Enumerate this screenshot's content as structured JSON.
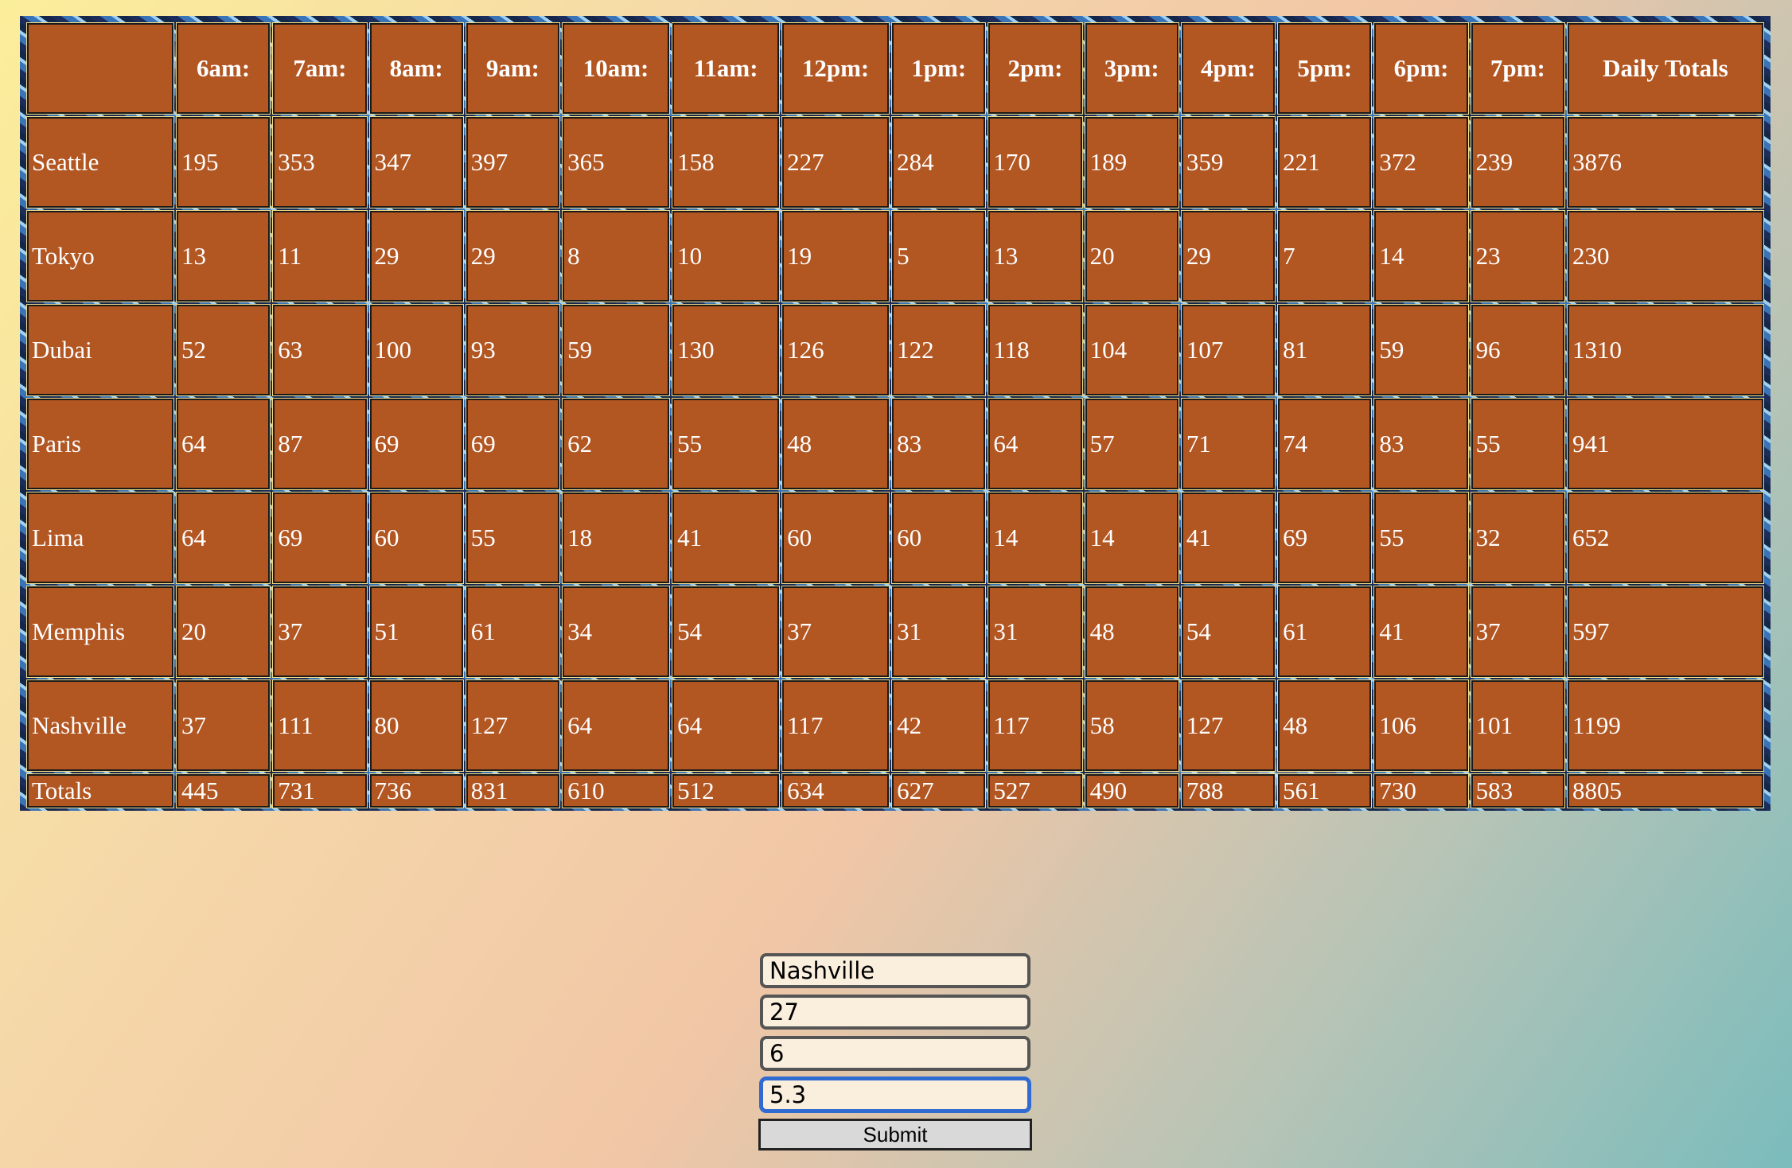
{
  "table": {
    "corner": "",
    "hours": [
      "6am:",
      "7am:",
      "8am:",
      "9am:",
      "10am:",
      "11am:",
      "12pm:",
      "1pm:",
      "2pm:",
      "3pm:",
      "4pm:",
      "5pm:",
      "6pm:",
      "7pm:"
    ],
    "total_header": "Daily Totals",
    "rows": [
      {
        "name": "Seattle",
        "values": [
          "195",
          "353",
          "347",
          "397",
          "365",
          "158",
          "227",
          "284",
          "170",
          "189",
          "359",
          "221",
          "372",
          "239"
        ],
        "total": "3876"
      },
      {
        "name": "Tokyo",
        "values": [
          "13",
          "11",
          "29",
          "29",
          "8",
          "10",
          "19",
          "5",
          "13",
          "20",
          "29",
          "7",
          "14",
          "23"
        ],
        "total": "230"
      },
      {
        "name": "Dubai",
        "values": [
          "52",
          "63",
          "100",
          "93",
          "59",
          "130",
          "126",
          "122",
          "118",
          "104",
          "107",
          "81",
          "59",
          "96"
        ],
        "total": "1310"
      },
      {
        "name": "Paris",
        "values": [
          "64",
          "87",
          "69",
          "69",
          "62",
          "55",
          "48",
          "83",
          "64",
          "57",
          "71",
          "74",
          "83",
          "55"
        ],
        "total": "941"
      },
      {
        "name": "Lima",
        "values": [
          "64",
          "69",
          "60",
          "55",
          "18",
          "41",
          "60",
          "60",
          "14",
          "14",
          "41",
          "69",
          "55",
          "32"
        ],
        "total": "652"
      },
      {
        "name": "Memphis",
        "values": [
          "20",
          "37",
          "51",
          "61",
          "34",
          "54",
          "37",
          "31",
          "31",
          "48",
          "54",
          "61",
          "41",
          "37"
        ],
        "total": "597"
      },
      {
        "name": "Nashville",
        "values": [
          "37",
          "111",
          "80",
          "127",
          "64",
          "64",
          "117",
          "42",
          "117",
          "58",
          "127",
          "48",
          "106",
          "101"
        ],
        "total": "1199"
      }
    ],
    "totals": {
      "label": "Totals",
      "values": [
        "445",
        "731",
        "736",
        "831",
        "610",
        "512",
        "634",
        "627",
        "527",
        "490",
        "788",
        "561",
        "730",
        "583"
      ],
      "grand_total": "8805"
    }
  },
  "form": {
    "location_value": "Nashville",
    "field2_value": "27",
    "field3_value": "6",
    "field4_value": "5.3",
    "submit_label": "Submit"
  },
  "colors": {
    "cell_fill": "#b25622",
    "cell_text": "#ffffff",
    "focus_border": "#2f6bd0"
  }
}
